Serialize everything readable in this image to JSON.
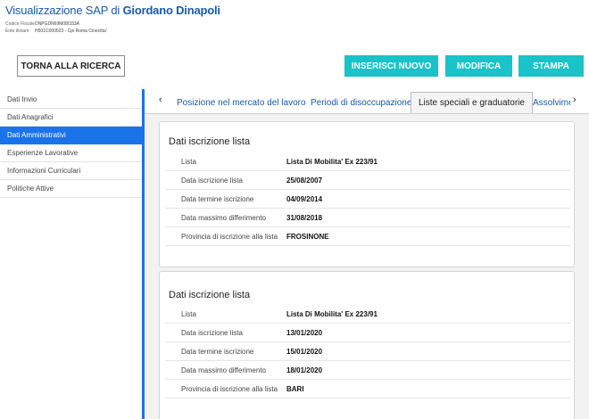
{
  "header": {
    "title_prefix": "Visualizzazione SAP di ",
    "title_name": "Giordano Dinapoli",
    "codice_fiscale_label": "Codice Fiscale",
    "codice_fiscale_value": "DNPGDN69M08I333A",
    "ente_label": "Ente titolare",
    "ente_value": "H501C000523 - Cpi Roma Cinecitta'"
  },
  "buttons": {
    "back": "TORNA ALLA RICERCA",
    "insert": "INSERISCI NUOVO",
    "edit": "MODIFICA",
    "print": "STAMPA"
  },
  "colors": {
    "accent": "#1a73e8",
    "button_teal": "#19c3c8",
    "title": "#1a5aa8"
  },
  "sidebar": {
    "items": [
      {
        "label": "Dati Invio",
        "active": false
      },
      {
        "label": "Dati Anagrafici",
        "active": false
      },
      {
        "label": "Dati Amministrativi",
        "active": true
      },
      {
        "label": "Esperienze Lavorative",
        "active": false
      },
      {
        "label": "Informazioni Curriculari",
        "active": false
      },
      {
        "label": "Politiche Attive",
        "active": false
      }
    ]
  },
  "tabs": {
    "left_arrow": "‹",
    "right_arrow": "›",
    "items": [
      {
        "label": "Posizione nel mercato del lavoro",
        "active": false
      },
      {
        "label": "Periodi di disoccupazione",
        "active": false
      },
      {
        "label": "Liste speciali e graduatorie",
        "active": true
      },
      {
        "label": "Assolvime",
        "active": false
      }
    ]
  },
  "cards": [
    {
      "title": "Dati iscrizione lista",
      "rows": [
        {
          "key": "Lista",
          "value": "Lista Di Mobilita' Ex 223/91"
        },
        {
          "key": "Data iscrizione lista",
          "value": "25/08/2007"
        },
        {
          "key": "Data termine iscrizione",
          "value": "04/09/2014"
        },
        {
          "key": "Data massimo differimento",
          "value": "31/08/2018"
        },
        {
          "key": "Provincia di iscrizione alla lista",
          "value": "FROSINONE"
        }
      ]
    },
    {
      "title": "Dati iscrizione lista",
      "rows": [
        {
          "key": "Lista",
          "value": "Lista Di Mobilita' Ex 223/91"
        },
        {
          "key": "Data iscrizione lista",
          "value": "13/01/2020"
        },
        {
          "key": "Data termine iscrizione",
          "value": "15/01/2020"
        },
        {
          "key": "Data massimo differimento",
          "value": "18/01/2020"
        },
        {
          "key": "Provincia di iscrizione alla lista",
          "value": "BARI"
        }
      ]
    }
  ]
}
